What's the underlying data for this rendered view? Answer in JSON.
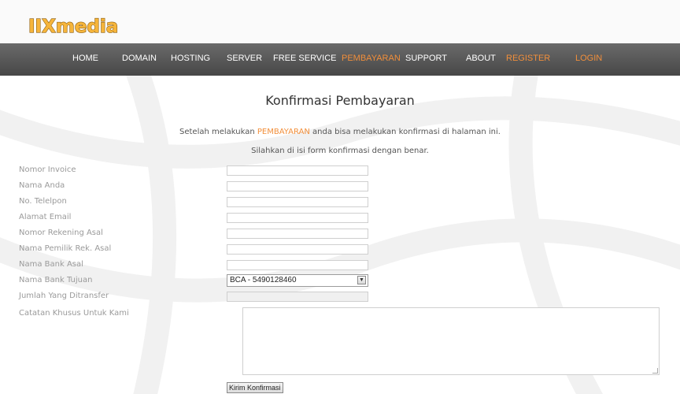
{
  "header": {
    "logo_text": "IIXmedia",
    "nav": [
      {
        "label": "HOME",
        "accent": false
      },
      {
        "label": "DOMAIN",
        "accent": false
      },
      {
        "label": "HOSTING",
        "accent": false
      },
      {
        "label": "SERVER",
        "accent": false
      },
      {
        "label": "FREE SERVICE",
        "accent": false
      },
      {
        "label": "PEMBAYARAN",
        "accent": true
      },
      {
        "label": "SUPPORT",
        "accent": false
      },
      {
        "label": "ABOUT",
        "accent": false
      },
      {
        "label": "REGISTER",
        "accent": true
      },
      {
        "label": "LOGIN",
        "accent": true
      }
    ]
  },
  "page": {
    "title": "Konfirmasi Pembayaran",
    "intro_before": "Setelah melakukan ",
    "intro_highlight": "PEMBAYARAN",
    "intro_after": " anda bisa melakukan konfirmasi di halaman ini.",
    "intro_line2": "Silahkan di isi form konfirmasi dengan benar."
  },
  "form": {
    "fields": [
      {
        "label": "Nomor Invoice",
        "value": ""
      },
      {
        "label": "Nama Anda",
        "value": ""
      },
      {
        "label": "No. Telelpon",
        "value": ""
      },
      {
        "label": "Alamat Email",
        "value": ""
      },
      {
        "label": "Nomor Rekening Asal",
        "value": ""
      },
      {
        "label": "Nama Pemilik Rek. Asal",
        "value": ""
      },
      {
        "label": "Nama Bank Asal",
        "value": ""
      }
    ],
    "bank_tujuan": {
      "label": "Nama Bank Tujuan",
      "selected": "BCA - 5490128460"
    },
    "jumlah": {
      "label": "Jumlah Yang Ditransfer",
      "value": ""
    },
    "catatan": {
      "label": "Catatan Khusus Untuk Kami",
      "value": ""
    },
    "submit_label": "Kirim Konfirmasi"
  },
  "colors": {
    "accent": "#f28f3b",
    "nav_bg": "#555555",
    "label": "#9a9a9a"
  }
}
